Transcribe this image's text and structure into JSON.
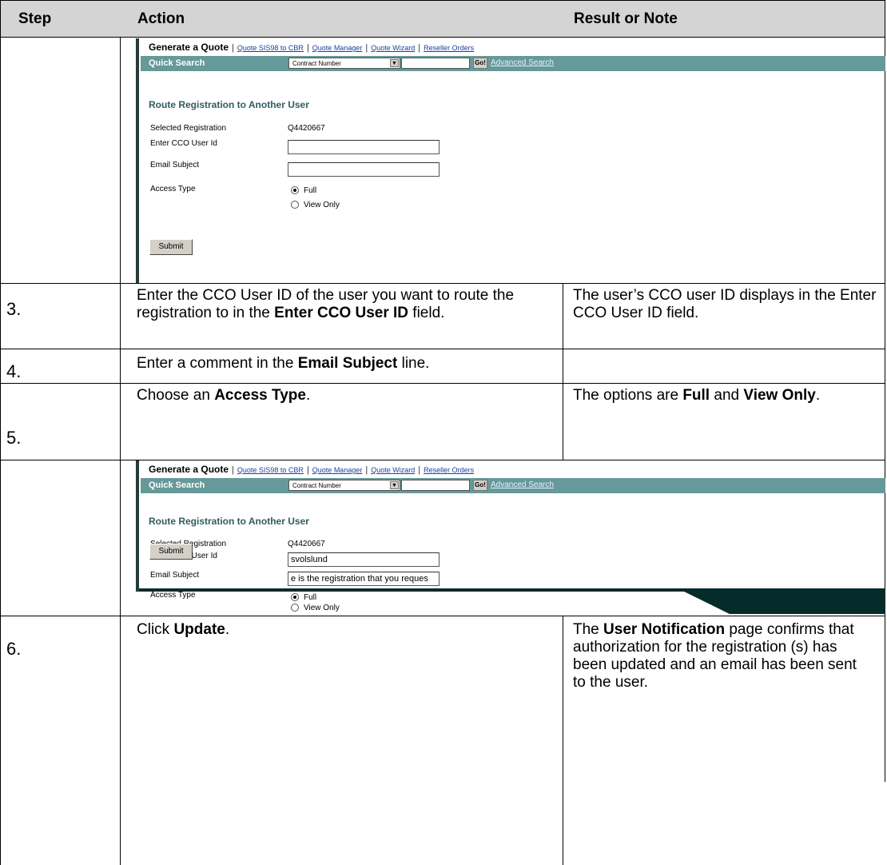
{
  "header": {
    "step": "Step",
    "action": "Action",
    "result": "Result or Note"
  },
  "shot": {
    "nav_main": "Generate a Quote",
    "nav_links": [
      "Quote SIS98 to CBR",
      "Quote Manager",
      "Quote Wizard",
      "Reseller Orders"
    ],
    "quick_search": "Quick Search",
    "search_select": "Contract Number",
    "go": "Go!",
    "advanced_search": "Advanced Search",
    "title": "Route Registration to Another User",
    "selected_registration_label": "Selected Registration",
    "selected_registration_value": "Q4420667",
    "user_id_label": "Enter CCO User Id",
    "email_subject_label": "Email Subject",
    "access_type_label": "Access Type",
    "radio_full": "Full",
    "radio_view_only": "View Only",
    "submit": "Submit"
  },
  "shot2_values": {
    "user_id": "svolslund",
    "email_subject": "e is the registration that you reques"
  },
  "rows": {
    "r3": {
      "step": "3.",
      "action_a": "Enter the CCO User ID of the user you want to route the registration to in the ",
      "action_b": "Enter CCO User ID",
      "action_c": " field.",
      "result": "The user’s CCO user ID displays in the Enter CCO User ID field."
    },
    "r4": {
      "step": "4.",
      "action_a": "Enter a comment in the ",
      "action_b": "Email Subject",
      "action_c": " line."
    },
    "r5": {
      "step": "5.",
      "action_a": "Choose an ",
      "action_b": "Access Type",
      "action_c": ".",
      "result_a": "The options are ",
      "result_b": "Full",
      "result_c": " and ",
      "result_d": "View Only",
      "result_e": "."
    },
    "r6": {
      "step": "6.",
      "action_a": "Click ",
      "action_b": "Update",
      "action_c": ".",
      "result_a": "The ",
      "result_b": "User Notification",
      "result_c": " page confirms that authorization for the registration (s) has been updated and an email has been sent to the user."
    }
  }
}
